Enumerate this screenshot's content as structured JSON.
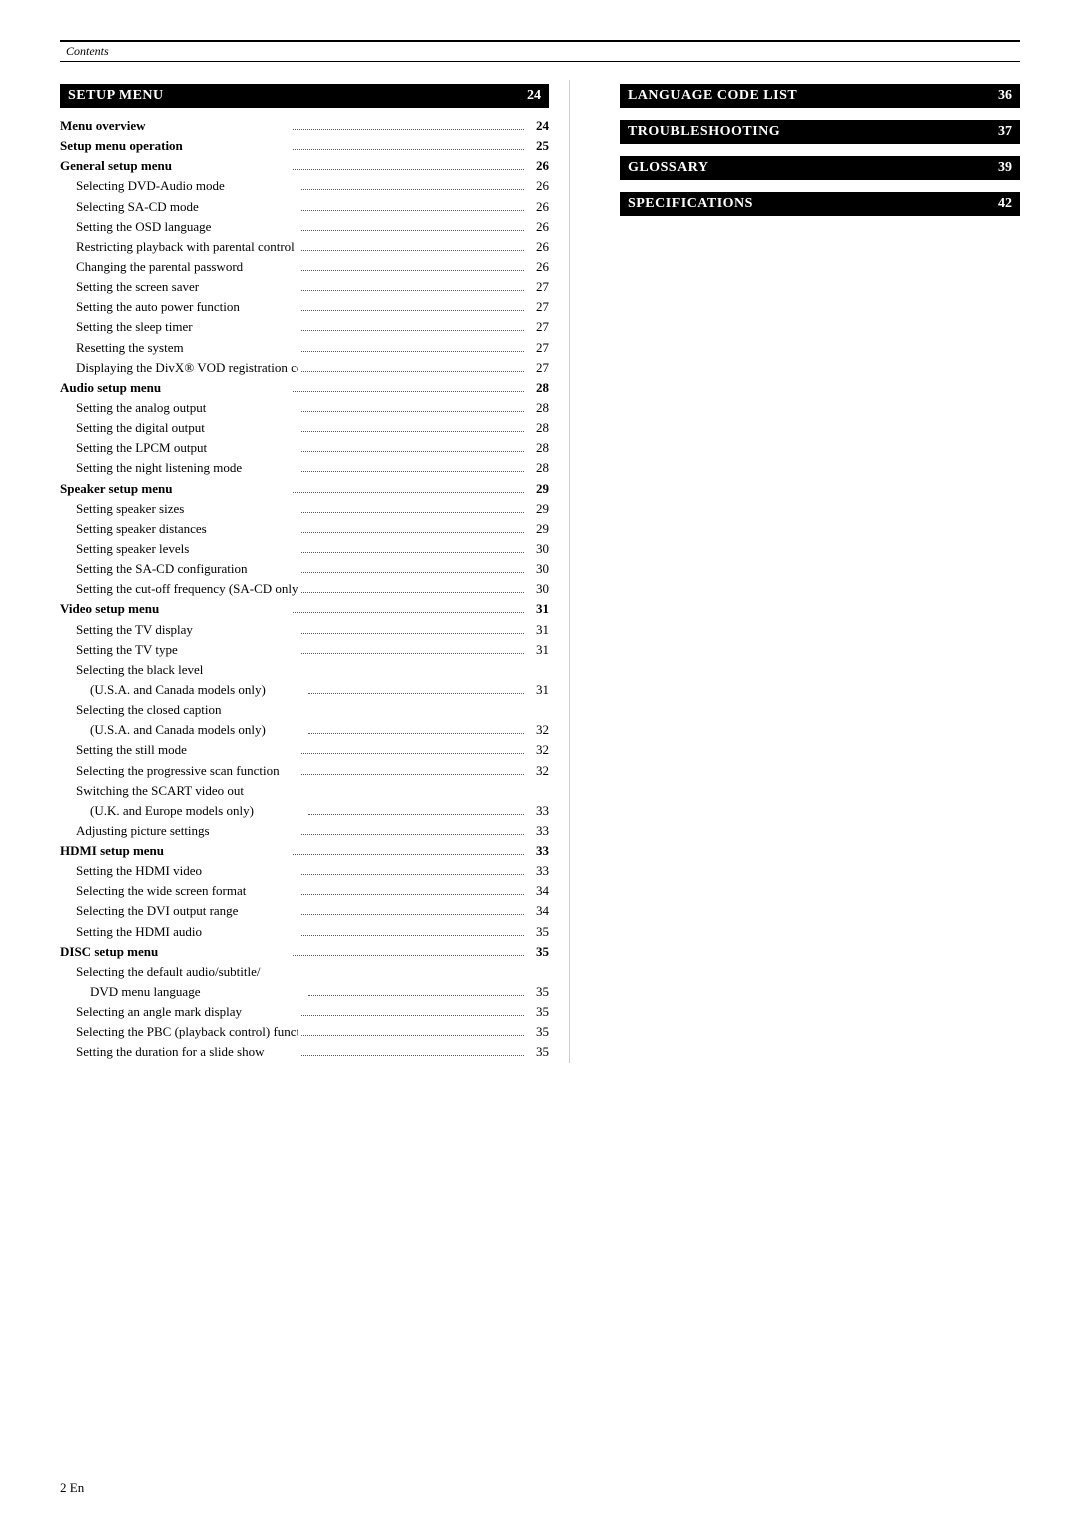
{
  "header": {
    "label": "Contents"
  },
  "footer": {
    "text": "2 En"
  },
  "left_column": {
    "sections": [
      {
        "id": "setup-menu",
        "title": "SETUP MENU",
        "page": "24",
        "entries": [
          {
            "label": "Menu overview",
            "dots": true,
            "page": "24",
            "indent": 0,
            "bold": true
          },
          {
            "label": "Setup menu operation",
            "dots": true,
            "page": "25",
            "indent": 0,
            "bold": true
          },
          {
            "label": "General setup menu",
            "dots": true,
            "page": "26",
            "indent": 0,
            "bold": true
          },
          {
            "label": "Selecting DVD-Audio mode",
            "dots": true,
            "page": "26",
            "indent": 1,
            "bold": false
          },
          {
            "label": "Selecting SA-CD mode",
            "dots": true,
            "page": "26",
            "indent": 1,
            "bold": false
          },
          {
            "label": "Setting the OSD language",
            "dots": true,
            "page": "26",
            "indent": 1,
            "bold": false
          },
          {
            "label": "Restricting playback with parental control",
            "dots": true,
            "page": "26",
            "indent": 1,
            "bold": false
          },
          {
            "label": "Changing the parental password",
            "dots": true,
            "page": "26",
            "indent": 1,
            "bold": false
          },
          {
            "label": "Setting the screen saver",
            "dots": true,
            "page": "27",
            "indent": 1,
            "bold": false
          },
          {
            "label": "Setting the auto power function",
            "dots": true,
            "page": "27",
            "indent": 1,
            "bold": false
          },
          {
            "label": "Setting the sleep timer",
            "dots": true,
            "page": "27",
            "indent": 1,
            "bold": false
          },
          {
            "label": "Resetting the system",
            "dots": true,
            "page": "27",
            "indent": 1,
            "bold": false
          },
          {
            "label": "Displaying the DivX® VOD registration code",
            "dots": true,
            "page": "27",
            "indent": 1,
            "bold": false
          },
          {
            "label": "Audio setup menu",
            "dots": true,
            "page": "28",
            "indent": 0,
            "bold": true
          },
          {
            "label": "Setting the analog output",
            "dots": true,
            "page": "28",
            "indent": 1,
            "bold": false
          },
          {
            "label": "Setting the digital output",
            "dots": true,
            "page": "28",
            "indent": 1,
            "bold": false
          },
          {
            "label": "Setting the LPCM output",
            "dots": true,
            "page": "28",
            "indent": 1,
            "bold": false
          },
          {
            "label": "Setting the night listening mode",
            "dots": true,
            "page": "28",
            "indent": 1,
            "bold": false
          },
          {
            "label": "Speaker setup menu",
            "dots": true,
            "page": "29",
            "indent": 0,
            "bold": true
          },
          {
            "label": "Setting speaker sizes",
            "dots": true,
            "page": "29",
            "indent": 1,
            "bold": false
          },
          {
            "label": "Setting speaker distances",
            "dots": true,
            "page": "29",
            "indent": 1,
            "bold": false
          },
          {
            "label": "Setting speaker levels",
            "dots": true,
            "page": "30",
            "indent": 1,
            "bold": false
          },
          {
            "label": "Setting the SA-CD configuration",
            "dots": true,
            "page": "30",
            "indent": 1,
            "bold": false
          },
          {
            "label": "Setting the cut-off frequency (SA-CD only)",
            "dots": true,
            "page": "30",
            "indent": 1,
            "bold": false
          },
          {
            "label": "Video setup menu",
            "dots": true,
            "page": "31",
            "indent": 0,
            "bold": true
          },
          {
            "label": "Setting the TV display",
            "dots": true,
            "page": "31",
            "indent": 1,
            "bold": false
          },
          {
            "label": "Setting the TV type",
            "dots": true,
            "page": "31",
            "indent": 1,
            "bold": false
          },
          {
            "label": "Selecting the black level",
            "dots": false,
            "page": "",
            "indent": 1,
            "bold": false,
            "multiline": true,
            "line2": "(U.S.A. and Canada models only)",
            "line2page": "31"
          },
          {
            "label": "Selecting the closed caption",
            "dots": false,
            "page": "",
            "indent": 1,
            "bold": false,
            "multiline": true,
            "line2": "(U.S.A. and Canada models only)",
            "line2page": "32"
          },
          {
            "label": "Setting the still mode",
            "dots": true,
            "page": "32",
            "indent": 1,
            "bold": false
          },
          {
            "label": "Selecting the progressive scan function",
            "dots": true,
            "page": "32",
            "indent": 1,
            "bold": false
          },
          {
            "label": "Switching the SCART video out",
            "dots": false,
            "page": "",
            "indent": 1,
            "bold": false,
            "multiline": true,
            "line2": "(U.K. and Europe models only)",
            "line2page": "33"
          },
          {
            "label": "Adjusting picture settings",
            "dots": true,
            "page": "33",
            "indent": 1,
            "bold": false
          },
          {
            "label": "HDMI setup menu",
            "dots": true,
            "page": "33",
            "indent": 0,
            "bold": true
          },
          {
            "label": "Setting the HDMI video",
            "dots": true,
            "page": "33",
            "indent": 1,
            "bold": false
          },
          {
            "label": "Selecting the wide screen format",
            "dots": true,
            "page": "34",
            "indent": 1,
            "bold": false
          },
          {
            "label": "Selecting the DVI output range",
            "dots": true,
            "page": "34",
            "indent": 1,
            "bold": false
          },
          {
            "label": "Setting the HDMI audio",
            "dots": true,
            "page": "35",
            "indent": 1,
            "bold": false
          },
          {
            "label": "DISC setup menu",
            "dots": true,
            "page": "35",
            "indent": 0,
            "bold": true
          },
          {
            "label": "Selecting the default audio/subtitle/",
            "dots": false,
            "page": "",
            "indent": 1,
            "bold": false,
            "multiline": true,
            "line2": "DVD menu language",
            "line2page": "35"
          },
          {
            "label": "Selecting an angle mark display",
            "dots": true,
            "page": "35",
            "indent": 1,
            "bold": false
          },
          {
            "label": "Selecting the PBC (playback control) function",
            "dots": true,
            "page": "35",
            "indent": 1,
            "bold": false
          },
          {
            "label": "Setting the duration for a slide show",
            "dots": true,
            "page": "35",
            "indent": 1,
            "bold": false
          }
        ]
      }
    ]
  },
  "right_column": {
    "sections": [
      {
        "title": "LANGUAGE CODE LIST",
        "page": "36"
      },
      {
        "title": "TROUBLESHOOTING",
        "page": "37"
      },
      {
        "title": "GLOSSARY",
        "page": "39"
      },
      {
        "title": "SPECIFICATIONS",
        "page": "42"
      }
    ]
  }
}
